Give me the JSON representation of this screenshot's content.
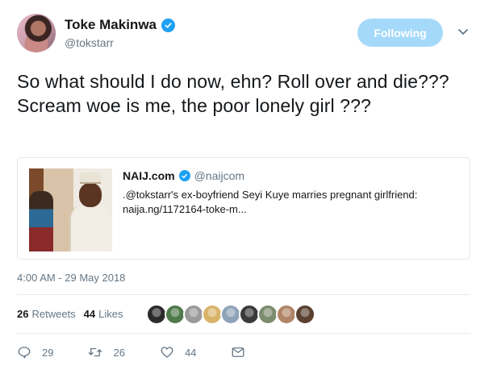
{
  "author": {
    "display_name": "Toke Makinwa",
    "handle": "@tokstarr",
    "verified": true
  },
  "follow_button": {
    "label": "Following"
  },
  "tweet": {
    "text": "So what should I do now, ehn? Roll over and die??? Scream woe is me, the poor lonely girl ???"
  },
  "quoted": {
    "name": "NAIJ.com",
    "handle": "@naijcom",
    "text": ".@tokstarr's ex-boyfriend Seyi Kuye marries pregnant girlfriend: naija.ng/1172164-toke-m..."
  },
  "timestamp": "4:00 AM - 29 May 2018",
  "stats": {
    "retweets_count": "26",
    "retweets_label": "Retweets",
    "likes_count": "44",
    "likes_label": "Likes"
  },
  "likers": [
    "#2b2b2b",
    "#4f7a4a",
    "#9a9a9a",
    "#d8b36a",
    "#8fa3b8",
    "#3a3a3a",
    "#7c8c6e",
    "#b08466",
    "#5a4030"
  ],
  "actions": {
    "replies": "29",
    "retweets": "26",
    "likes": "44"
  },
  "colors": {
    "accent": "#1da1f2",
    "follow_button_bg": "#a4d9f9",
    "muted_text": "#657786"
  },
  "icons": {
    "verified": "verified-badge-icon",
    "caret": "chevron-down-icon",
    "reply": "reply-icon",
    "retweet": "retweet-icon",
    "like": "heart-icon",
    "dm": "envelope-icon"
  }
}
